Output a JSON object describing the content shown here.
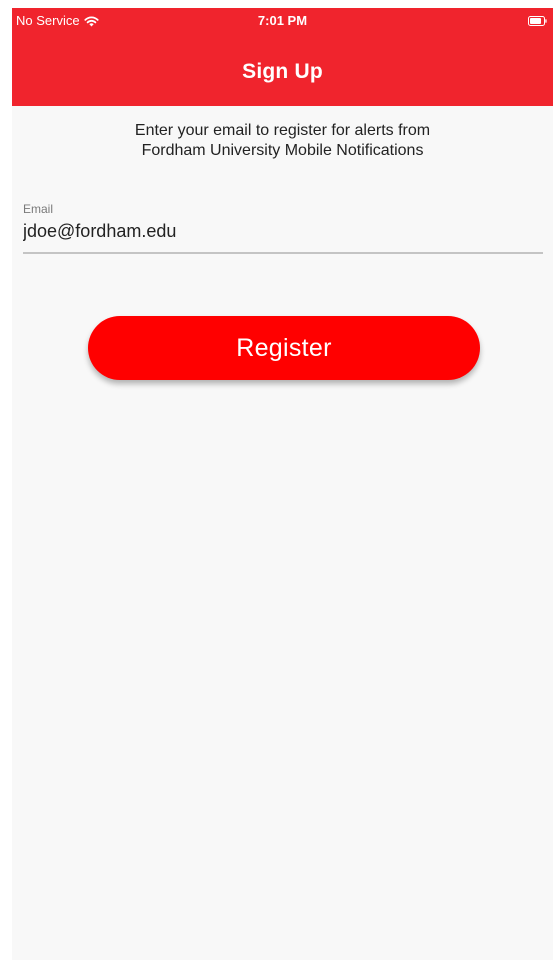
{
  "status_bar": {
    "carrier": "No Service",
    "time": "7:01 PM",
    "wifi_icon": "wifi-icon",
    "battery_icon": "battery-icon"
  },
  "app_bar": {
    "title": "Sign Up",
    "color": "#f0242d"
  },
  "instructions": {
    "line1": "Enter your email to register for alerts from",
    "line2": "Fordham University Mobile Notifications"
  },
  "email_field": {
    "label": "Email",
    "value": "jdoe@fordham.edu"
  },
  "register_button": {
    "label": "Register",
    "color": "#ff0000"
  }
}
